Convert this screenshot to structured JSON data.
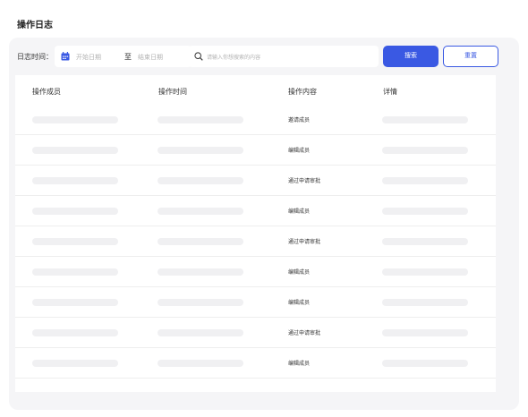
{
  "page_title": "操作日志",
  "filter": {
    "date_label": "日志时间：",
    "start_placeholder": "开始日期",
    "separator": "至",
    "end_placeholder": "结束日期",
    "search_placeholder": "请输入你想搜索的内容",
    "search_button": "搜索",
    "reset_button": "重置"
  },
  "table": {
    "headers": [
      "操作成员",
      "操作时间",
      "操作内容",
      "详情"
    ],
    "rows": [
      {
        "content": "邀请成员"
      },
      {
        "content": "编辑成员"
      },
      {
        "content": "通过申请审批"
      },
      {
        "content": "编辑成员"
      },
      {
        "content": "通过申请审批"
      },
      {
        "content": "编辑成员"
      },
      {
        "content": "编辑成员"
      },
      {
        "content": "通过申请审批"
      },
      {
        "content": "编辑成员"
      }
    ]
  },
  "colors": {
    "primary": "#3a59e3",
    "panel_bg": "#f5f5f7",
    "placeholder_bar": "#f0f0f2"
  }
}
